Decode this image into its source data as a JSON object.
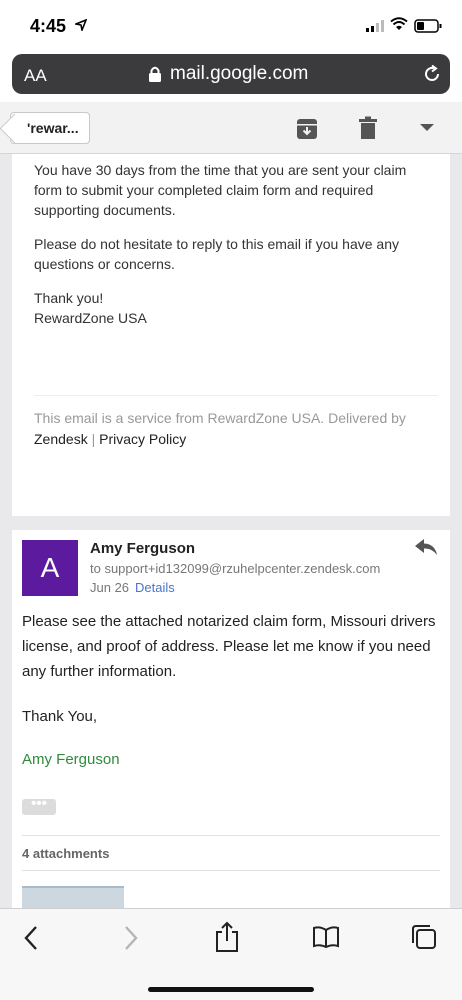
{
  "status_bar": {
    "time": "4:45"
  },
  "browser": {
    "aa_label": "AA",
    "url": "mail.google.com"
  },
  "mail_toolbar": {
    "back_label": "'rewar..."
  },
  "message1": {
    "paragraph1": "You have 30 days from the time that you are sent your claim form to submit your completed claim form and required supporting documents.",
    "paragraph2": "Please do not hesitate to reply to this email if you have any questions or concerns.",
    "thanks": "Thank you!",
    "company": "RewardZone USA",
    "footer_prefix": "This email is a service from RewardZone USA. Delivered by",
    "footer_link": "Zendesk",
    "footer_separator": "|",
    "footer_policy": "Privacy Policy"
  },
  "message2": {
    "avatar_letter": "A",
    "sender": "Amy Ferguson",
    "recipient": "to support+id132099@rzuhelpcenter.zendesk.com",
    "date": "Jun 26",
    "details_label": "Details",
    "body": "Please see the attached notarized claim form, Missouri drivers license, and proof of address. Please let me know if you need any further information.",
    "closing": "Thank You,",
    "signature": "Amy Ferguson",
    "ellipsis": "•••",
    "attachments_label": "4 attachments"
  },
  "colors": {
    "avatar": "#5c1b9e",
    "signature": "#2e8b3c",
    "link": "#4a76c9"
  },
  "icons": [
    "location-arrow-icon",
    "signal-icon",
    "wifi-icon",
    "battery-icon",
    "lock-icon",
    "reload-icon",
    "archive-icon",
    "trash-icon",
    "chevron-down-icon",
    "reply-icon",
    "back-icon",
    "forward-icon",
    "share-icon",
    "bookmarks-icon",
    "tabs-icon"
  ]
}
